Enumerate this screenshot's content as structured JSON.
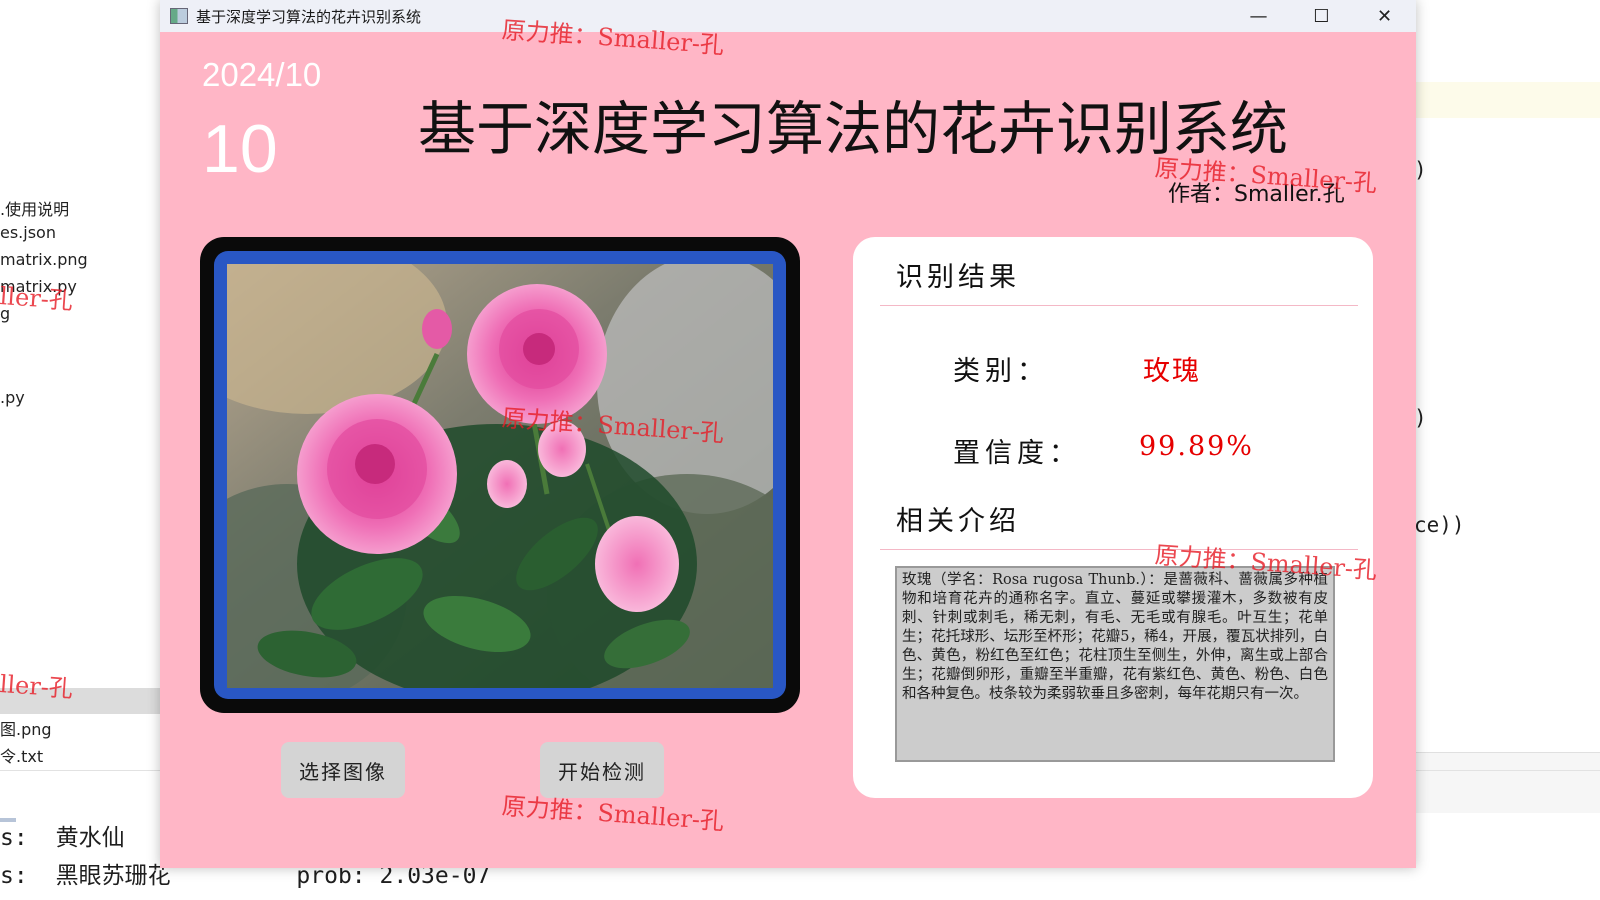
{
  "background": {
    "files": [
      ".使用说明",
      "es.json",
      "matrix.png",
      "matrix.py",
      "g",
      ".py",
      "图.png",
      "令.txt"
    ],
    "code_fragments": [
      ")",
      ")",
      "ce))"
    ],
    "terminal_lines": [
      {
        "prefix": "s:",
        "name": "黄水仙"
      },
      {
        "prefix": "s:",
        "name": "黑眼苏珊花",
        "prob": "prob: 2.03e-07"
      }
    ]
  },
  "window": {
    "title": "基于深度学习算法的花卉识别系统",
    "controls": {
      "minimize": "—",
      "maximize": "☐",
      "close": "✕"
    }
  },
  "header": {
    "date": "2024/10",
    "day": "10",
    "title": "基于深度学习算法的花卉识别系统",
    "author": "作者：Smaller.孔"
  },
  "buttons": {
    "select_image": "选择图像",
    "start_detect": "开始检测"
  },
  "results": {
    "heading": "识别结果",
    "category_label": "类别：",
    "category_value": "玫瑰",
    "confidence_label": "置信度：",
    "confidence_value": "99.89%",
    "intro_heading": "相关介绍",
    "intro_text": "玫瑰（学名：Rosa rugosa Thunb.）：是蔷薇科、蔷薇属多种植物和培育花卉的通称名字。直立、蔓延或攀援灌木，多数被有皮刺、针刺或刺毛，稀无刺，有毛、无毛或有腺毛。叶互生；花单生；花托球形、坛形至杯形；花瓣5，稀4，开展，覆瓦状排列，白色、黄色，粉红色至红色；花柱顶生至侧生，外伸，离生或上部合生；花瓣倒卵形，重瓣至半重瓣，花有紫红色、黄色、粉色、白色和各种复色。枝条较为柔弱软垂且多密刺，每年花期只有一次。"
  },
  "watermark": "原力推：Smaller-孔",
  "watermark_partial": {
    "left_mid": "ller-孔",
    "left_bottom": "ller-孔"
  },
  "colors": {
    "window_bg": "#ffb6c6",
    "frame_blue": "#2957c4",
    "result_red": "#e60000",
    "watermark": "#e61e28"
  }
}
